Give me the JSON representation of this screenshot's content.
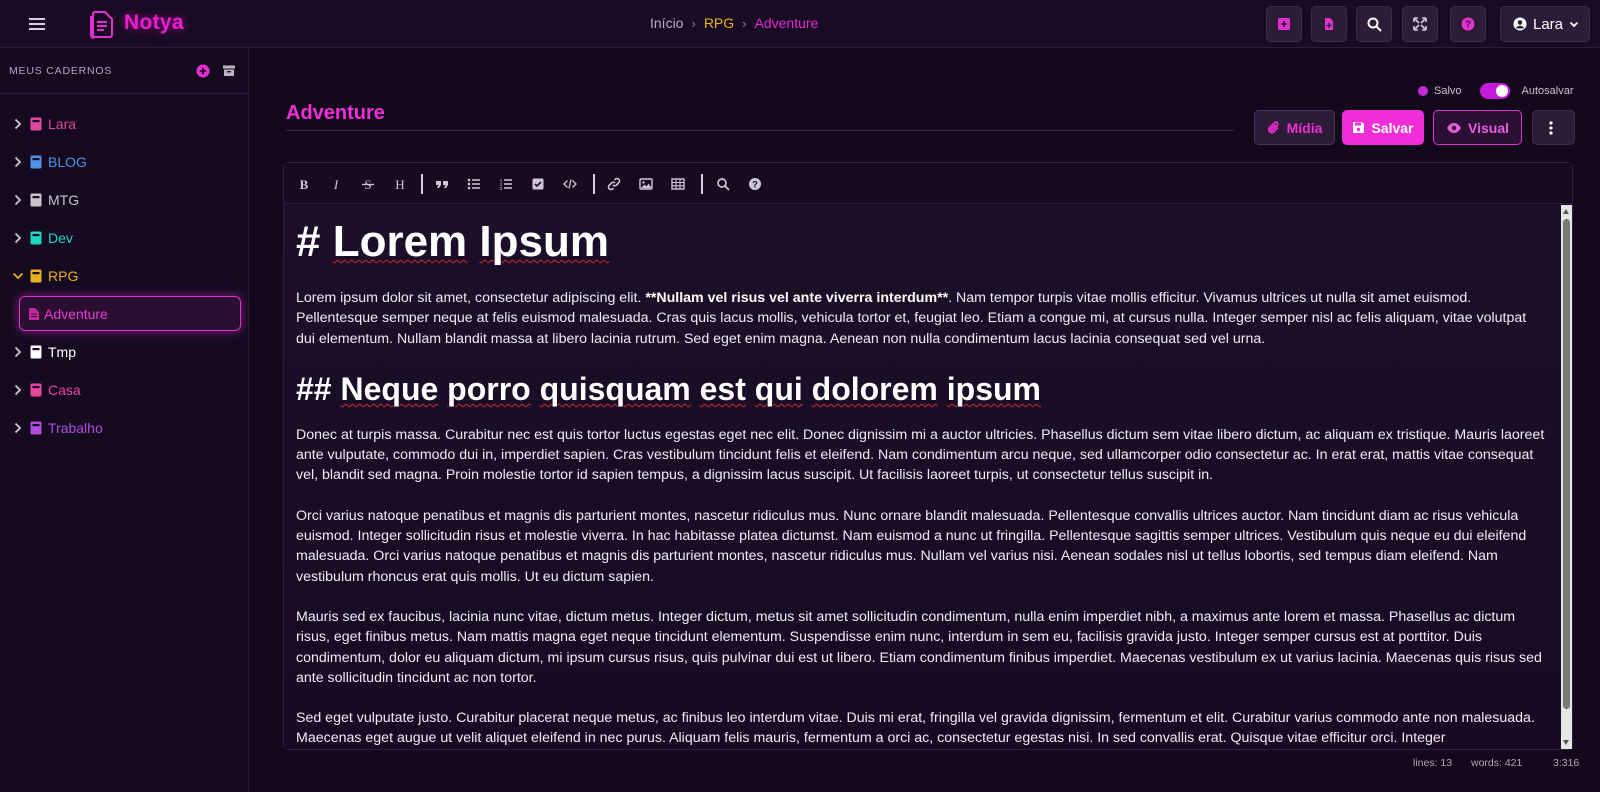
{
  "app": {
    "brand": "Notya"
  },
  "breadcrumb": {
    "home": "Início",
    "notebook": "RPG",
    "note": "Adventure"
  },
  "topbar": {
    "user": "Lara"
  },
  "sidebar": {
    "title": "MEUS CADERNOS",
    "notebooks": [
      {
        "label": "Lara",
        "color": "#e0479f"
      },
      {
        "label": "BLOG",
        "color": "#4f93e8"
      },
      {
        "label": "MTG",
        "color": "#c9c2d1"
      },
      {
        "label": "Dev",
        "color": "#1fd6c5"
      },
      {
        "label": "RPG",
        "color": "#e7b21f"
      },
      {
        "label": "Tmp",
        "color": "#ffffff"
      },
      {
        "label": "Casa",
        "color": "#e9459f"
      },
      {
        "label": "Trabalho",
        "color": "#b04de0"
      }
    ],
    "active_note": "Adventure"
  },
  "editor": {
    "saved_label": "Salvo",
    "autosave_label": "Autosalvar",
    "title": "Adventure",
    "buttons": {
      "media": "Mídia",
      "save": "Salvar",
      "visual": "Visual"
    },
    "content": {
      "h1": "# Lorem Ipsum",
      "p1_a": "Lorem ipsum dolor sit amet, consectetur adipiscing elit. ",
      "p1_bold": "**Nullam vel risus vel ante viverra interdum**",
      "p1_b": ". Nam tempor turpis vitae mollis efficitur. Vivamus ultrices ut nulla sit amet euismod. Pellentesque semper neque at felis euismod malesuada. Cras quis lacus mollis, vehicula tortor et, feugiat leo. Etiam a congue mi, at cursus nulla. Integer semper nisl ac felis aliquam, vitae volutpat dui elementum. Nullam blandit massa at libero lacinia rutrum. Sed eget enim magna. Aenean non nulla condimentum lacus lacinia consequat sed vel urna.",
      "h2": "## Neque porro quisquam est qui dolorem ipsum",
      "p2": "Donec at turpis massa. Curabitur nec est quis tortor luctus egestas eget nec elit. Donec dignissim mi a auctor ultricies. Phasellus dictum sem vitae libero dictum, ac aliquam ex tristique. Mauris laoreet ante vulputate, commodo dui in, imperdiet sapien. Cras vestibulum tincidunt felis et eleifend. Nam condimentum arcu neque, sed ullamcorper odio consectetur ac. In erat erat, mattis vitae consequat vel, blandit sed magna. Proin molestie tortor id sapien tempus, a dignissim lacus suscipit. Ut facilisis laoreet turpis, ut consectetur tellus suscipit in.",
      "p3": "Orci varius natoque penatibus et magnis dis parturient montes, nascetur ridiculus mus. Nunc ornare blandit malesuada. Pellentesque convallis ultrices auctor. Nam tincidunt diam ac risus vehicula euismod. Integer sollicitudin risus et molestie viverra. In hac habitasse platea dictumst. Nam euismod a nunc ut fringilla. Pellentesque sagittis semper ultrices. Vestibulum quis neque eu dui eleifend malesuada. Orci varius natoque penatibus et magnis dis parturient montes, nascetur ridiculus mus. Nullam vel varius nisi. Aenean sodales nisl ut tellus lobortis, sed tempus diam eleifend. Nam vestibulum rhoncus erat quis mollis. Ut eu dictum sapien.",
      "p4": "Mauris sed ex faucibus, lacinia nunc vitae, dictum metus. Integer dictum, metus sit amet sollicitudin condimentum, nulla enim imperdiet nibh, a maximus ante lorem et massa. Phasellus ac dictum risus, eget finibus metus. Nam mattis magna eget neque tincidunt elementum. Suspendisse enim nunc, interdum in sem eu, facilisis gravida justo. Integer semper cursus est at porttitor. Duis condimentum, dolor eu aliquam dictum, mi ipsum cursus risus, quis pulvinar dui est ut libero. Etiam condimentum finibus imperdiet. Maecenas vestibulum ex ut varius lacinia. Maecenas quis risus sed ante sollicitudin tincidunt ac non tortor.",
      "p5": "Sed eget vulputate justo. Curabitur placerat neque metus, ac finibus leo interdum vitae. Duis mi erat, fringilla vel gravida dignissim, fermentum et elit. Curabitur varius commodo ante non malesuada. Maecenas eget augue ut velit aliquet eleifend in nec purus. Aliquam felis mauris, fermentum a orci ac, consectetur egestas nisi. In sed convallis erat. Quisque vitae efficitur orci. Integer"
    }
  },
  "status": {
    "lines": "lines: 13",
    "words": "words: 421",
    "cursor": "3:316"
  },
  "colors": {
    "accent": "#f12dd8",
    "rpg": "#e7b21f",
    "background": "#14081d"
  }
}
